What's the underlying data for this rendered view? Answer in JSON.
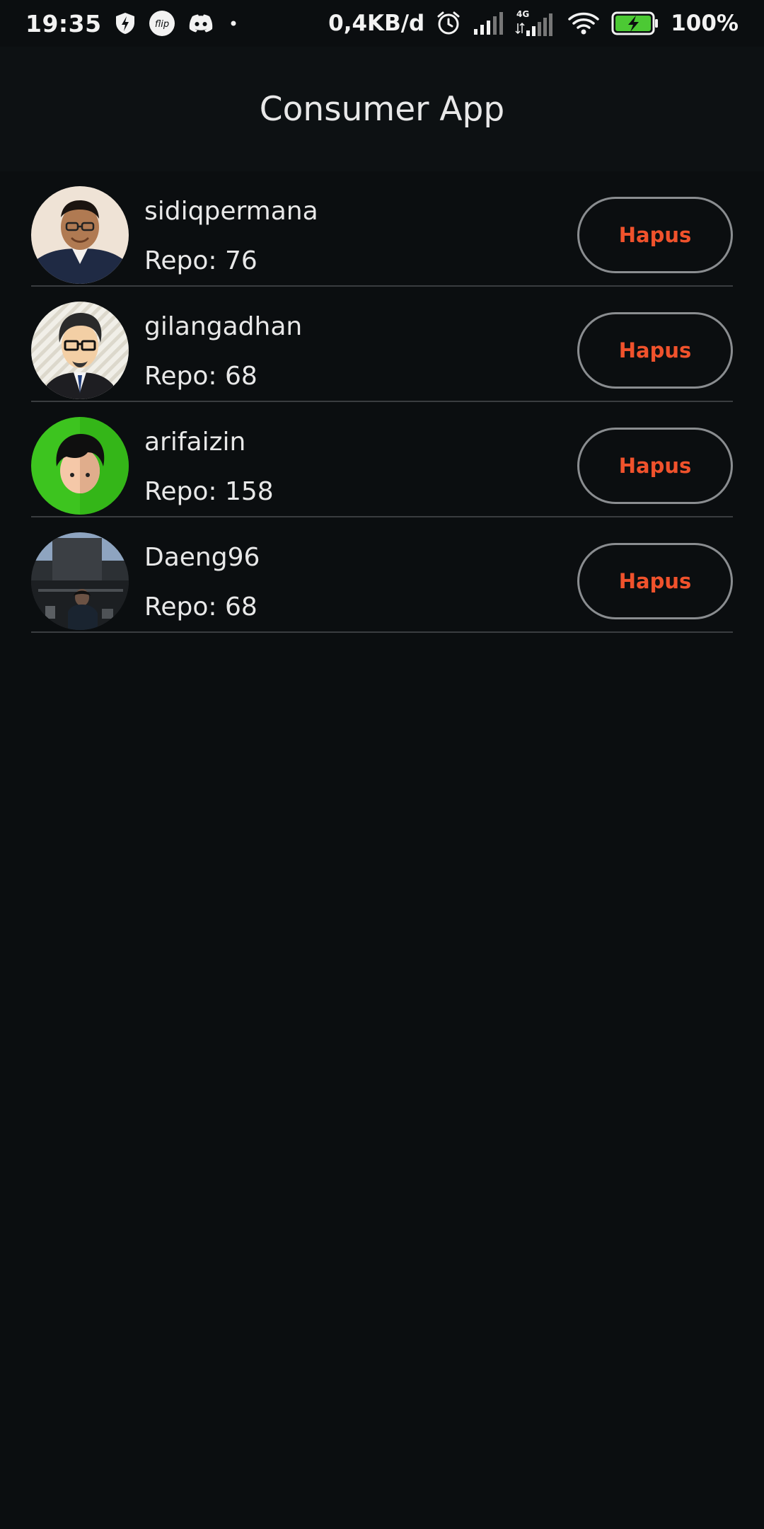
{
  "status_bar": {
    "time": "19:35",
    "net_speed": "0,4KB/d",
    "network_type": "4G",
    "battery": "100%",
    "icons_left": [
      "shield-bolt-icon",
      "flip-icon",
      "discord-icon",
      "dot-icon"
    ],
    "icons_right": [
      "alarm-icon",
      "signal-icon",
      "signal-4g-icon",
      "wifi-icon",
      "battery-charging-icon"
    ]
  },
  "app_bar": {
    "title": "Consumer App"
  },
  "users": [
    {
      "username": "sidiqpermana",
      "repo": "Repo: 76",
      "button": "Hapus"
    },
    {
      "username": "gilangadhan",
      "repo": "Repo: 68",
      "button": "Hapus"
    },
    {
      "username": "arifaizin",
      "repo": "Repo: 158",
      "button": "Hapus"
    },
    {
      "username": "Daeng96",
      "repo": "Repo: 68",
      "button": "Hapus"
    }
  ],
  "colors": {
    "background": "#0b0e10",
    "app_bar": "#0d1113",
    "accent": "#f0522c",
    "divider": "#3a3d40"
  }
}
